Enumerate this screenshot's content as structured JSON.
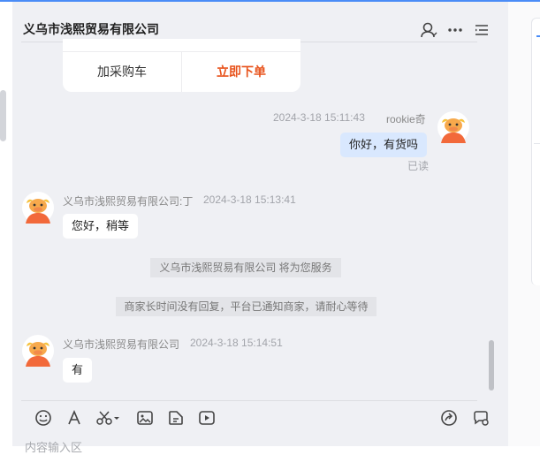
{
  "header": {
    "title": "义乌市浅熙贸易有限公司"
  },
  "product_card": {
    "add_cart_label": "加采购车",
    "order_now_label": "立即下单"
  },
  "messages": [
    {
      "timestamp": "2024-3-18 15:11:43",
      "sender": "rookie奇",
      "text": "你好，有货吗",
      "status": "已读"
    },
    {
      "sender": "义乌市浅熙贸易有限公司:丁",
      "timestamp": "2024-3-18 15:13:41",
      "text": "您好，稍等"
    },
    {
      "sender": "义乌市浅熙贸易有限公司",
      "timestamp": "2024-3-18 15:14:51",
      "text": "有"
    }
  ],
  "system_notices": [
    "义乌市浅熙贸易有限公司 将为您服务",
    "商家长时间没有回复，平台已通知商家，请耐心等待"
  ],
  "composer": {
    "placeholder": "内容输入区"
  },
  "icons": {
    "header": [
      "user-icon",
      "more-icon",
      "list-icon"
    ],
    "toolbar": [
      "emoji-icon",
      "font-icon",
      "scissors-icon",
      "image-icon",
      "file-icon",
      "video-icon",
      "share-icon",
      "chat-settings-icon"
    ]
  },
  "colors": {
    "accent": "#4a8cf7",
    "order": "#e8531c",
    "my_bubble": "#d9e8fe",
    "avatar": "#f2693a"
  }
}
